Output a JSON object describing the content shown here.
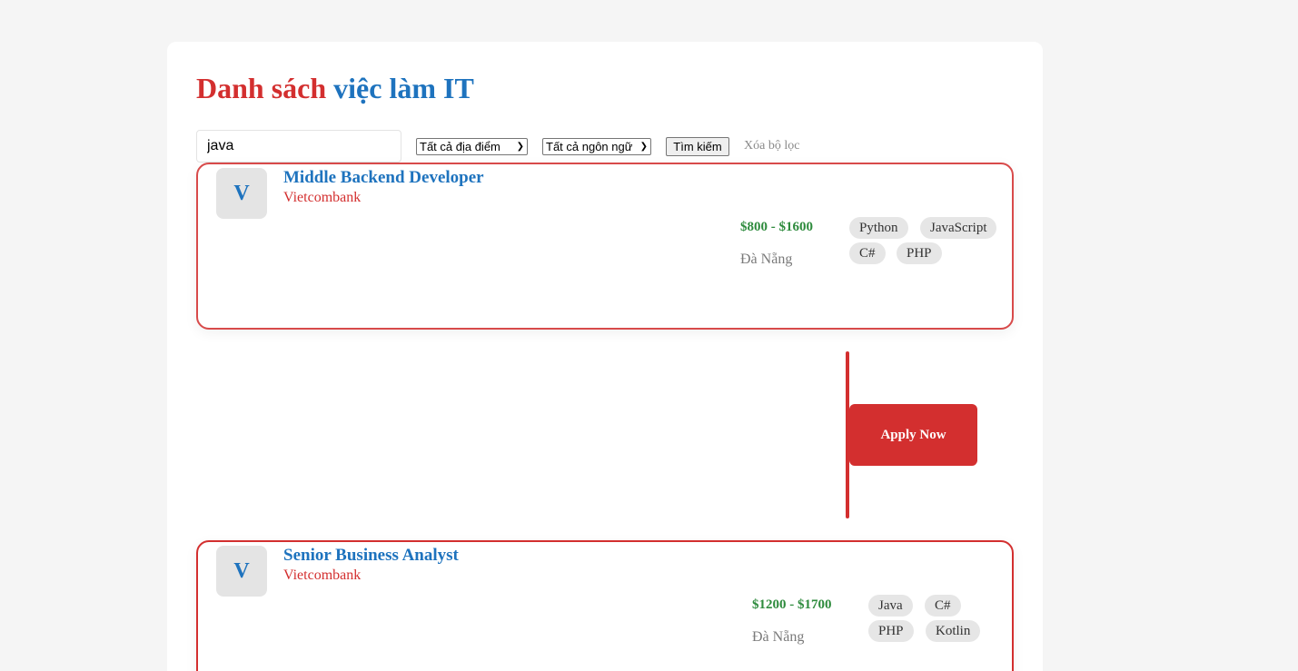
{
  "page": {
    "title_part1": "Danh sách",
    "title_part2": "việc làm IT"
  },
  "filters": {
    "search_value": "java",
    "location_selected": "Tất cả địa điểm",
    "language_selected": "Tất cả ngôn ngữ",
    "search_button": "Tìm kiếm",
    "clear_link": "Xóa bộ lọc"
  },
  "jobs": [
    {
      "logo_letter": "V",
      "title": "Middle Backend Developer",
      "company": "Vietcombank",
      "salary": "$800 - $1600",
      "location": "Đà Nẵng",
      "tags": [
        "Python",
        "JavaScript",
        "C#",
        "PHP"
      ]
    },
    {
      "logo_letter": "V",
      "title": "Senior Business Analyst",
      "company": "Vietcombank",
      "salary": "$1200 - $1700",
      "location": "Đà Nẵng",
      "tags": [
        "Java",
        "C#",
        "PHP",
        "Kotlin"
      ]
    }
  ],
  "apply": {
    "label": "Apply Now"
  },
  "colors": {
    "accent_red": "#d32f2f",
    "accent_blue": "#1e73be",
    "salary_green": "#2e8b3d"
  }
}
